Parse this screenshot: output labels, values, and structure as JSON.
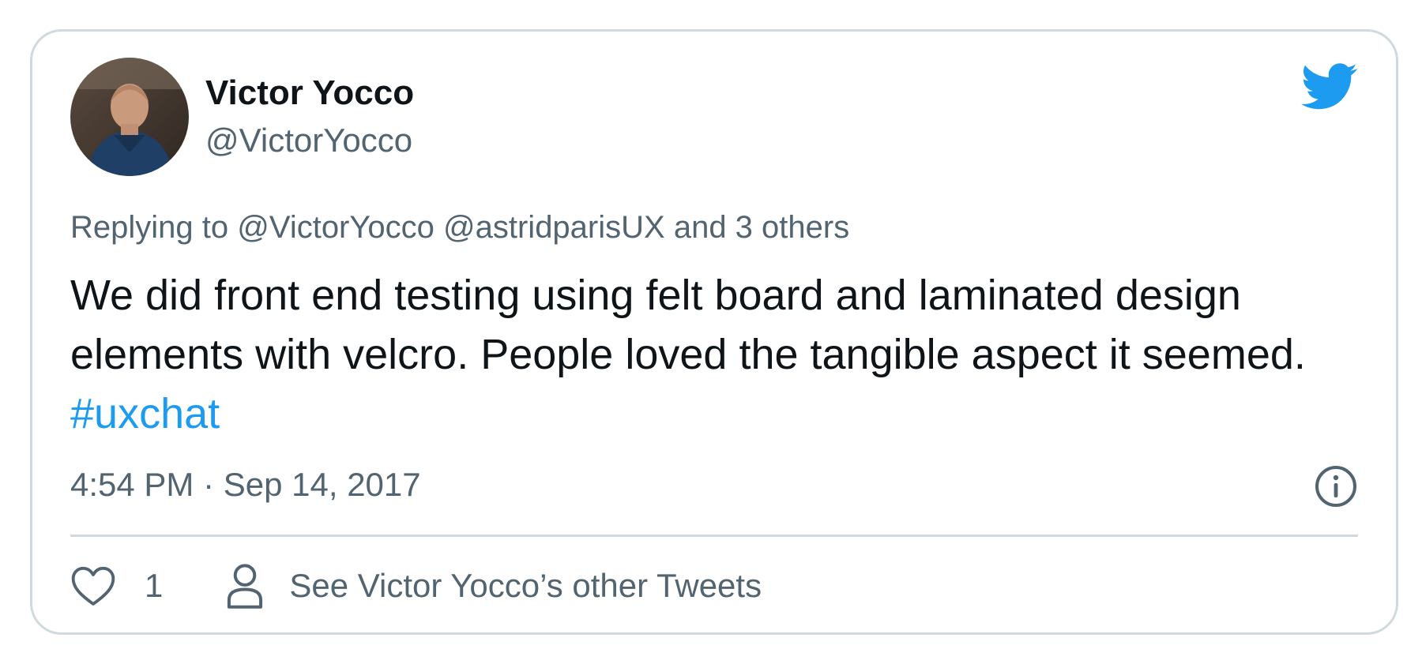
{
  "author": {
    "name": "Victor Yocco",
    "handle": "@VictorYocco"
  },
  "reply": {
    "prefix": "Replying to",
    "mentions": [
      "@VictorYocco",
      "@astridparisUX"
    ],
    "suffix": "and 3 others"
  },
  "tweet": {
    "text": "We did front end testing using felt board and laminated design elements with velcro. People loved the tangible aspect it seemed.",
    "hashtag": "#uxchat"
  },
  "timestamp": "4:54 PM · Sep 14, 2017",
  "actions": {
    "likes": "1",
    "profile_link": "See Victor Yocco’s other Tweets"
  },
  "icons": {
    "brand": "twitter-bird-icon",
    "info": "info-icon",
    "like": "heart-icon",
    "profile": "person-icon"
  },
  "colors": {
    "brand": "#1d9bf0",
    "text_primary": "#0f1419",
    "text_secondary": "#536471",
    "border": "#cfd9de"
  }
}
